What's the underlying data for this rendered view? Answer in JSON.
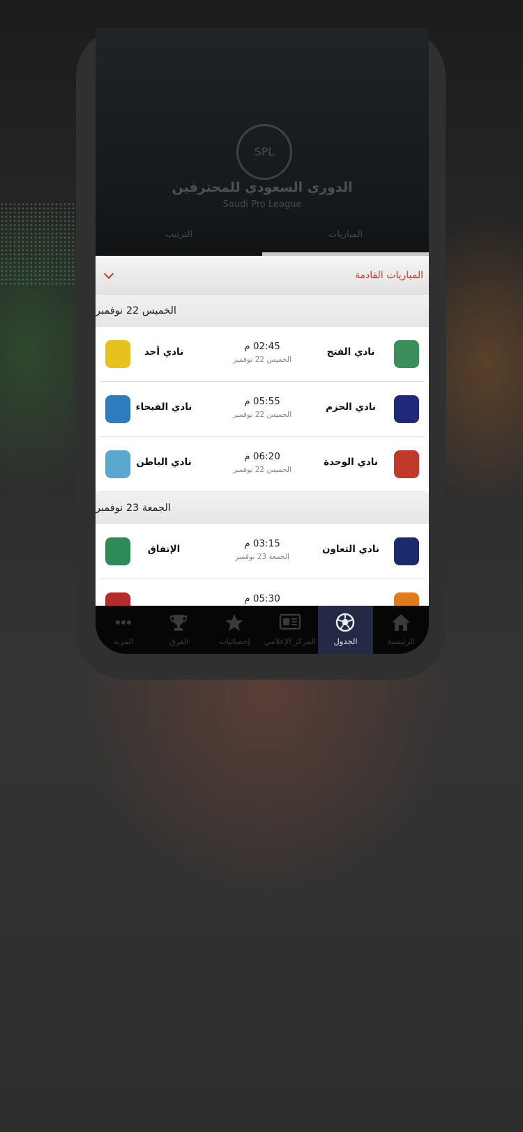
{
  "hero": {
    "league_name_ar": "الدوري السعودي للمحترفين",
    "league_name_en": "Saudi Pro League",
    "tabs": [
      "المباريات",
      "الترتيب"
    ]
  },
  "panel": {
    "title": "المباريات القادمة"
  },
  "days": [
    {
      "label": "الخميس 22 نوفمبر",
      "matches": [
        {
          "home": "نادي الفتح",
          "away": "نادي أحد",
          "time": "02:45 م",
          "date": "الخميس 22 نوفمبر",
          "home_color": "#3a8f5a",
          "away_color": "#e8c21c"
        },
        {
          "home": "نادي الحزم",
          "away": "نادي الفيحاء",
          "time": "05:55 م",
          "date": "الخميس 22 نوفمبر",
          "home_color": "#1f2a7a",
          "away_color": "#2f7bc0"
        },
        {
          "home": "نادي الوحدة",
          "away": "نادي الباطن",
          "time": "06:20 م",
          "date": "الخميس 22 نوفمبر",
          "home_color": "#c0392b",
          "away_color": "#5aa7cf"
        }
      ]
    },
    {
      "label": "الجمعة 23 نوفمبر",
      "matches": [
        {
          "home": "نادي التعاون",
          "away": "الإتفاق",
          "time": "03:15 م",
          "date": "الجمعة 23 نوفمبر",
          "home_color": "#1b2a6b",
          "away_color": "#2e8b57"
        },
        {
          "home": "",
          "away": "",
          "time": "05:30 م",
          "date": "",
          "home_color": "#e07b1a",
          "away_color": "#b52a2a"
        }
      ]
    }
  ],
  "nav": [
    {
      "label": "الرئيسية",
      "icon": "home-icon",
      "active": false
    },
    {
      "label": "الجدول",
      "icon": "soccer-ball-icon",
      "active": true
    },
    {
      "label": "المركز الإعلامي",
      "icon": "newspaper-icon",
      "active": false
    },
    {
      "label": "إحصائيات",
      "icon": "star-icon",
      "active": false
    },
    {
      "label": "الفرق",
      "icon": "trophy-icon",
      "active": false
    },
    {
      "label": "المزيد",
      "icon": "more-icon",
      "active": false
    }
  ]
}
